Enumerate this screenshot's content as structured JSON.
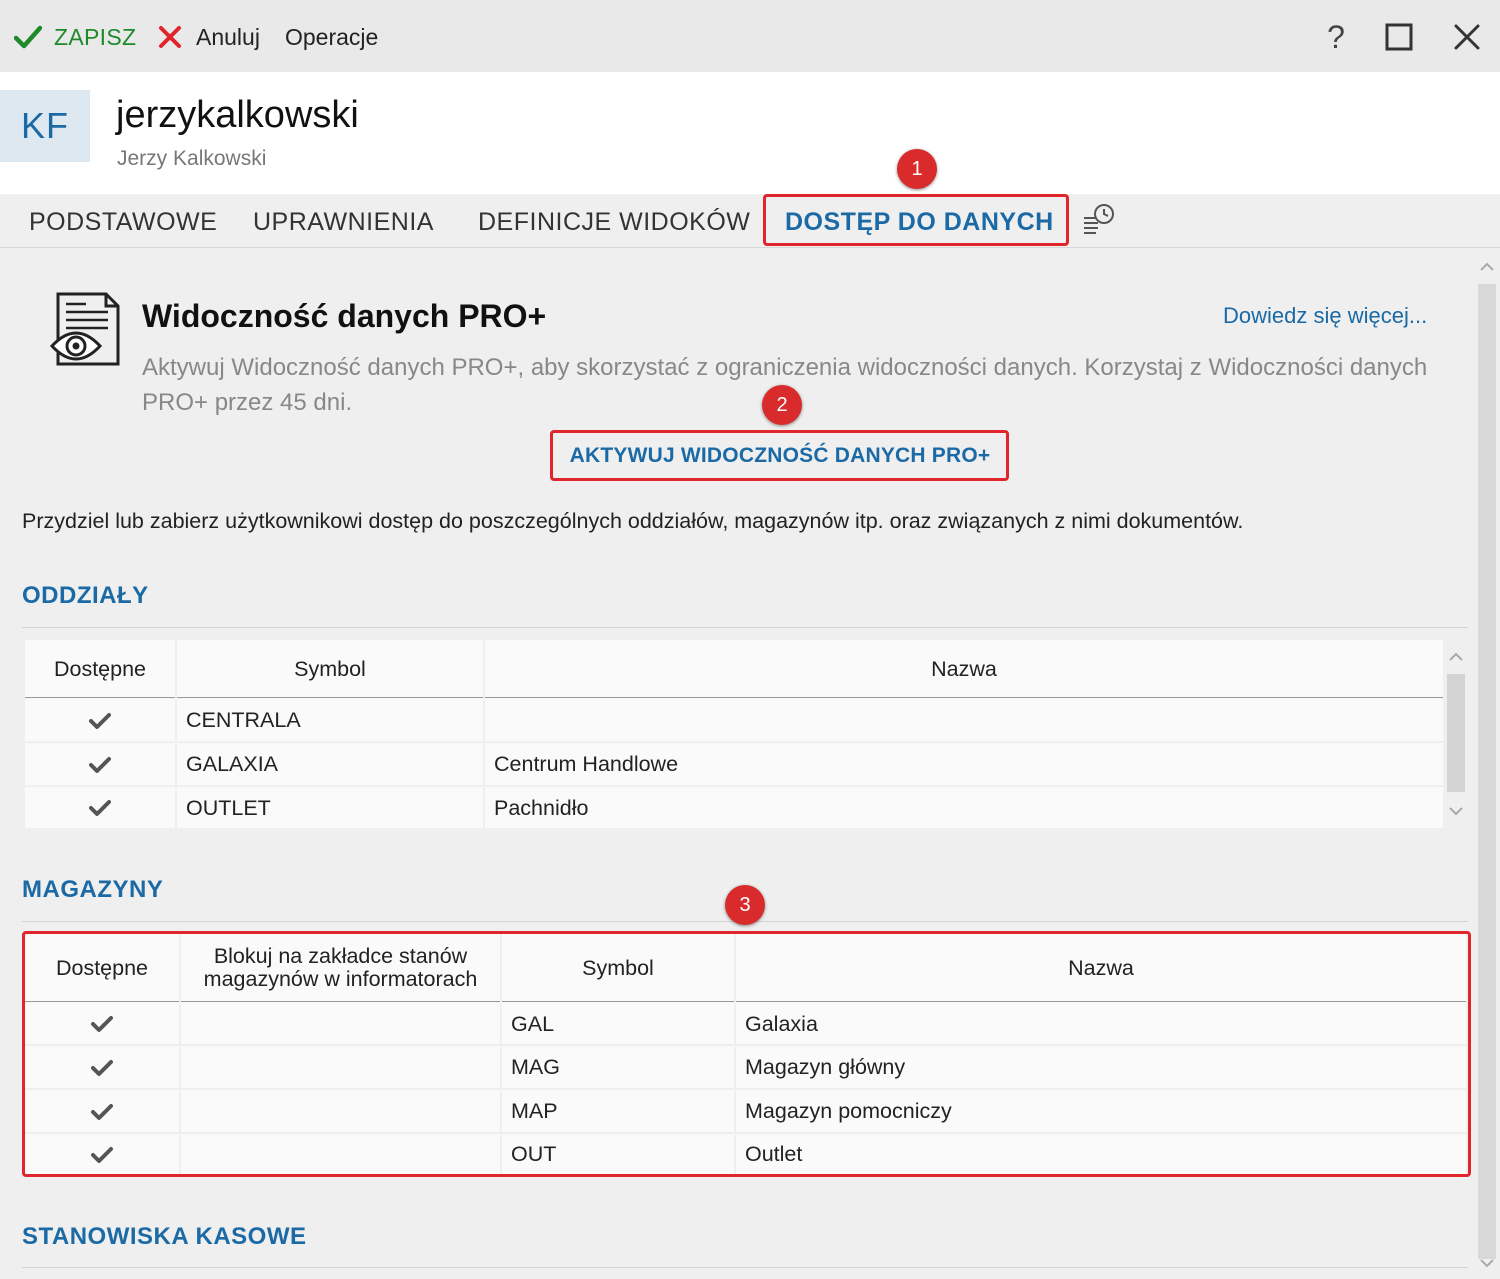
{
  "toolbar": {
    "save_label": "ZAPISZ",
    "cancel_label": "Anuluj",
    "operations_label": "Operacje",
    "help_label": "?"
  },
  "user": {
    "initials": "KF",
    "login": "jerzykalkowski",
    "full_name": "Jerzy Kalkowski"
  },
  "tabs": [
    {
      "label": "PODSTAWOWE"
    },
    {
      "label": "UPRAWNIENIA"
    },
    {
      "label": "DEFINICJE WIDOKÓW"
    },
    {
      "label": "DOSTĘP DO DANYCH",
      "active": true
    }
  ],
  "annotations": [
    "1",
    "2",
    "3"
  ],
  "pro_panel": {
    "title": "Widoczność danych PRO+",
    "learn_more": "Dowiedz się więcej...",
    "description": "Aktywuj Widoczność danych PRO+, aby skorzystać z ograniczenia widoczności danych. Korzystaj z Widoczności danych PRO+ przez 45 dni.",
    "activate_button": "AKTYWUJ WIDOCZNOŚĆ DANYCH PRO+"
  },
  "intro_text": "Przydziel lub zabierz użytkownikowi dostęp do poszczególnych oddziałów, magazynów itp. oraz związanych z nimi dokumentów.",
  "branches": {
    "title": "ODDZIAŁY",
    "headers": [
      "Dostępne",
      "Symbol",
      "Nazwa"
    ],
    "rows": [
      {
        "available": true,
        "symbol": "CENTRALA",
        "name": ""
      },
      {
        "available": true,
        "symbol": "GALAXIA",
        "name": "Centrum Handlowe"
      },
      {
        "available": true,
        "symbol": "OUTLET",
        "name": "Pachnidło"
      }
    ]
  },
  "warehouses": {
    "title": "MAGAZYNY",
    "headers": [
      "Dostępne",
      "Blokuj na zakładce stanów magazynów w informatorach",
      "Symbol",
      "Nazwa"
    ],
    "rows": [
      {
        "available": true,
        "block": "",
        "symbol": "GAL",
        "name": "Galaxia"
      },
      {
        "available": true,
        "block": "",
        "symbol": "MAG",
        "name": "Magazyn główny"
      },
      {
        "available": true,
        "block": "",
        "symbol": "MAP",
        "name": "Magazyn pomocniczy"
      },
      {
        "available": true,
        "block": "",
        "symbol": "OUT",
        "name": "Outlet"
      }
    ]
  },
  "pos": {
    "title": "STANOWISKA KASOWE"
  },
  "colors": {
    "accent": "#1b6aa5",
    "save_green": "#1e8a2a",
    "cancel_red": "#e0262c",
    "annotation_red": "#d92b2b"
  }
}
